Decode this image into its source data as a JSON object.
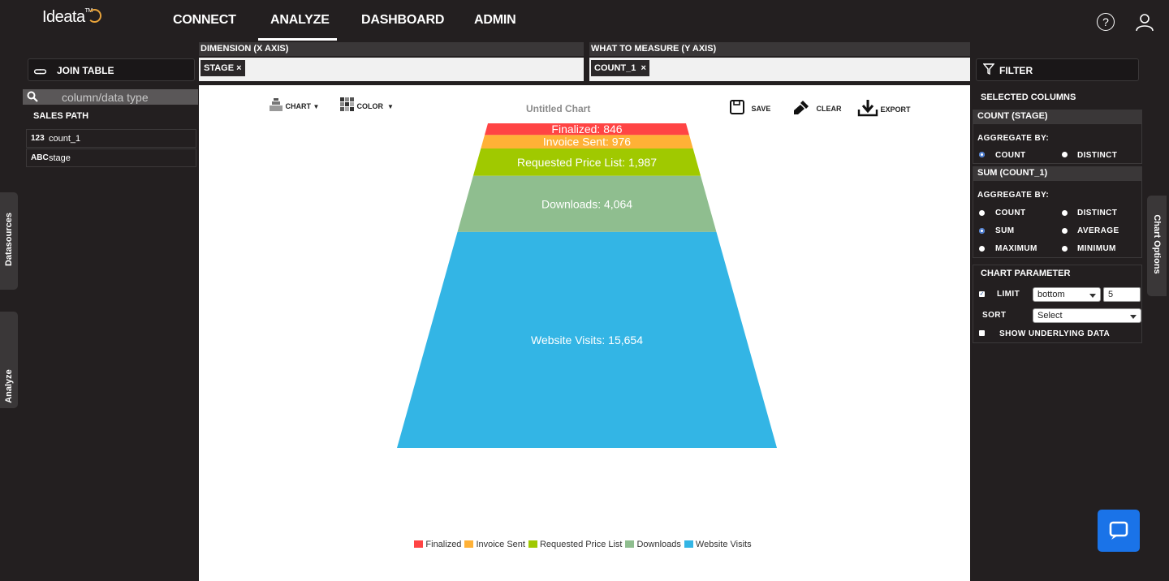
{
  "app": {
    "logo": "Ideata",
    "logo_tm": "TM"
  },
  "nav": {
    "items": [
      "CONNECT",
      "ANALYZE",
      "DASHBOARD",
      "ADMIN"
    ],
    "active": "ANALYZE"
  },
  "left_panel": {
    "join_table": "JOIN TABLE",
    "search_placeholder": "column/data type",
    "section_title": "SALES PATH",
    "fields": [
      {
        "type_icon": "123",
        "name": "count_1"
      },
      {
        "type_icon": "ABC",
        "name": "stage"
      }
    ],
    "vtabs": [
      "Datasources",
      "Analyze"
    ]
  },
  "axes": {
    "x_header": "DIMENSION (X AXIS)",
    "x_value": "STAGE",
    "y_header": "WHAT TO MEASURE (Y AXIS)",
    "y_value": "COUNT_1",
    "remove_glyph": "×"
  },
  "toolbar": {
    "chart": "CHART",
    "color": "COLOR",
    "save": "SAVE",
    "clear": "CLEAR",
    "export": "EXPORT"
  },
  "chart_data": {
    "type": "funnel",
    "title": "Untitled Chart",
    "categories": [
      "Finalized",
      "Invoice Sent",
      "Requested Price List",
      "Downloads",
      "Website Visits"
    ],
    "values": [
      846,
      976,
      1987,
      4064,
      15654
    ],
    "data_labels": [
      "Finalized: 846",
      "Invoice Sent: 976",
      "Requested Price List: 1,987",
      "Downloads: 4,064",
      "Website Visits: 15,654"
    ],
    "colors": [
      "#ff4444",
      "#ffb136",
      "#a0c900",
      "#8fbe8f",
      "#33b5e5"
    ],
    "legend_position": "bottom"
  },
  "right_panel": {
    "filter": "FILTER",
    "selected_columns": "SELECTED COLUMNS",
    "group1": {
      "title": "COUNT (STAGE)",
      "aggregate_by": "AGGREGATE BY:",
      "options": [
        "COUNT",
        "DISTINCT"
      ],
      "selected": "COUNT"
    },
    "group2": {
      "title": "SUM (COUNT_1)",
      "aggregate_by": "AGGREGATE BY:",
      "options": [
        "COUNT",
        "DISTINCT",
        "SUM",
        "AVERAGE",
        "MAXIMUM",
        "MINIMUM"
      ],
      "selected": "SUM"
    },
    "chart_parameter": {
      "title": "CHART PARAMETER",
      "limit_label": "LIMIT",
      "limit_checked": true,
      "limit_mode": "bottom",
      "limit_value": "5",
      "sort_label": "SORT",
      "sort_value": "Select",
      "show_underlying": "SHOW UNDERLYING DATA"
    },
    "vtab": "Chart Options"
  },
  "colors": {
    "background": "#231f20",
    "chat_button": "#1a73e8"
  }
}
